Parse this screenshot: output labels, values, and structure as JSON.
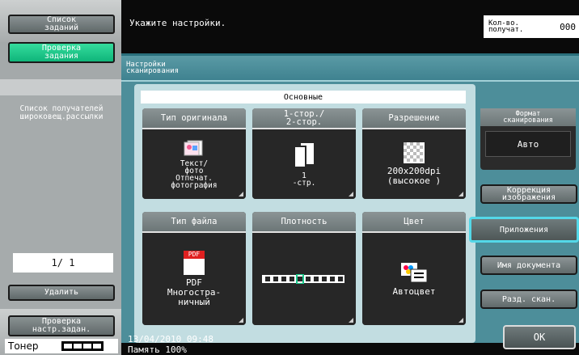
{
  "sidebar": {
    "job_list": "Список\nзаданий",
    "job_check": "Проверка\nзадания",
    "note": "Список получателей\nшироковещ.рассылки",
    "pager": "1/  1",
    "delete": "Удалить",
    "check_settings": "Проверка\nнастр.задан.",
    "toner_label": "Тонер"
  },
  "header": {
    "instruction": "Укажите настройки.",
    "count_label": "Кол-во.\nполучат.",
    "count_value": "000"
  },
  "panel": {
    "title": "Настройки\nсканирования",
    "basic_tab": "Основные"
  },
  "tiles": {
    "original_type": {
      "label": "Тип оригинала",
      "value": "Текст/\nфото\nОтпечат.\nфотография"
    },
    "duplex": {
      "label": "1-стор./\n2-стор.",
      "value": "1\n-стр."
    },
    "resolution": {
      "label": "Разрешение",
      "value": "200x200dpi\n(высокое )"
    },
    "file_type": {
      "label": "Тип файла",
      "value": "PDF\nМногостра-\nничный",
      "icon_text": "PDF"
    },
    "density": {
      "label": "Плотность"
    },
    "color": {
      "label": "Цвет",
      "value": "Автоцвет"
    }
  },
  "right_panel": {
    "scan_size_label": "Формат\nсканирования",
    "scan_size_value": "Авто",
    "image_correction": "Коррекция\nизображения",
    "attachments": "Приложения",
    "document_name": "Имя документа",
    "separate_scan": "Разд. скан."
  },
  "footer": {
    "datetime": "13/04/2010   09:48",
    "memory": "Память      100%",
    "ok": "OK"
  },
  "colors": {
    "accent_green": "#1bc88a",
    "panel_teal": "#4d8e9a",
    "active_outline": "#54d8e8"
  },
  "density_level": 5
}
